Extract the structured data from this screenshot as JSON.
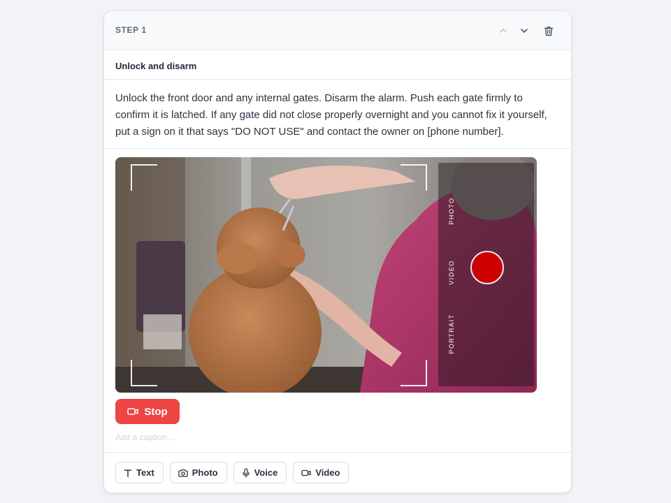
{
  "card": {
    "step_label": "STEP 1",
    "title": "Unlock and disarm",
    "body": "Unlock the front door and any internal gates. Disarm the alarm. Push each gate firmly to confirm it is latched. If any gate did not close properly overnight and you cannot fix it yourself, put a sign on it that says \"DO NOT USE\" and contact the owner on [phone number]."
  },
  "header_icons": [
    "chevron-up-icon",
    "chevron-down-icon",
    "trash-icon"
  ],
  "camera": {
    "modes": [
      "PHOTO",
      "VIDEO",
      "PORTRAIT"
    ],
    "active_mode": "VIDEO",
    "record_color": "#cc0000"
  },
  "recording": {
    "stop_label": "Stop",
    "stop_color": "#ef4444"
  },
  "caption": {
    "placeholder": "Add a caption...",
    "value": ""
  },
  "toolbar": {
    "text_label": "Text",
    "photo_label": "Photo",
    "voice_label": "Voice",
    "video_label": "Video"
  }
}
